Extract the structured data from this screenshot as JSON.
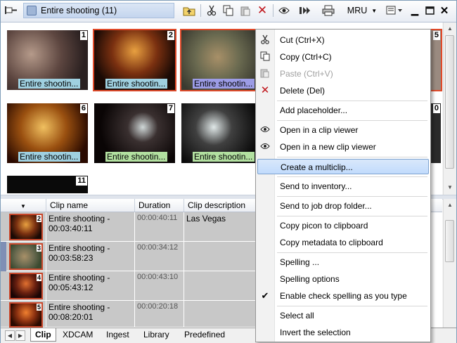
{
  "toolbar": {
    "bin_title": "Entire shooting (11)",
    "mru_label": "MRU"
  },
  "thumbs": [
    {
      "num": "1",
      "caption": "Entire shootin...",
      "selected": false,
      "caption_color": "#9fd0e0"
    },
    {
      "num": "2",
      "caption": "Entire shootin...",
      "selected": true,
      "caption_color": "#9fd0e0"
    },
    {
      "num": "",
      "caption": "Entire shootin...",
      "selected": true,
      "caption_color": "#9c9ce6"
    },
    {
      "num": "6",
      "caption": "Entire shootin...",
      "selected": false,
      "caption_color": "#9fd0e0"
    },
    {
      "num": "7",
      "caption": "Entire shootin...",
      "selected": false,
      "caption_color": "#b2e0a0"
    },
    {
      "num": "",
      "caption": "Entire shootin...",
      "selected": false,
      "caption_color": "#b2e0a0"
    },
    {
      "num": "11",
      "caption": "",
      "selected": false,
      "caption_color": ""
    }
  ],
  "partial_thumb_nums": {
    "right_top": "5",
    "right_mid": "0"
  },
  "table": {
    "headers": {
      "clip_name": "Clip name",
      "duration": "Duration",
      "description": "Clip description"
    },
    "rows": [
      {
        "num": "2",
        "name": "Entire shooting -",
        "tc": "00:03:40:11",
        "duration": "00:00:40:11",
        "description": "Las Vegas"
      },
      {
        "num": "3",
        "name": "Entire shooting -",
        "tc": "00:03:58:23",
        "duration": "00:00:34:12",
        "description": ""
      },
      {
        "num": "4",
        "name": "Entire shooting -",
        "tc": "00:05:43:12",
        "duration": "00:00:43:10",
        "description": ""
      },
      {
        "num": "5",
        "name": "Entire shooting -",
        "tc": "00:08:20:01",
        "duration": "00:00:20:18",
        "description": ""
      }
    ]
  },
  "tabs": [
    "Clip",
    "XDCAM",
    "Ingest",
    "Library",
    "Predefined"
  ],
  "menu": {
    "cut": "Cut (Ctrl+X)",
    "copy": "Copy (Ctrl+C)",
    "paste": "Paste (Ctrl+V)",
    "delete": "Delete (Del)",
    "add_placeholder": "Add placeholder...",
    "open_clip_viewer": "Open in a clip viewer",
    "open_new_clip_viewer": "Open in a new clip viewer",
    "create_multiclip": "Create a multiclip...",
    "send_inventory": "Send to inventory...",
    "send_job_drop": "Send to job drop folder...",
    "copy_picon": "Copy picon to clipboard",
    "copy_metadata": "Copy metadata to clipboard",
    "spelling": "Spelling ...",
    "spelling_options": "Spelling options",
    "enable_spelling": "Enable check spelling as you type",
    "select_all": "Select all",
    "invert_selection": "Invert the selection"
  }
}
